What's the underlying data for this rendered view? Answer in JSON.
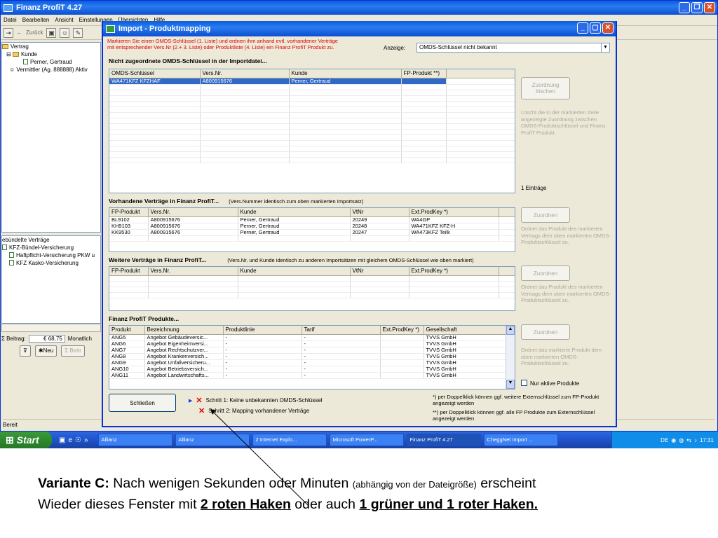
{
  "main_window": {
    "title": "Finanz ProfiT 4.27",
    "menu": [
      "Datei",
      "Bearbeiten",
      "Ansicht",
      "Einstellungen",
      "Übersichten",
      "Hilfe"
    ],
    "toolbar_back": "Zurück",
    "tree": {
      "root": "Vertrag",
      "kunde": "Kunde",
      "kunde_name": "Perner, Gertraud",
      "vermittler": "Vermittler (Ag. 888888) Aktiv"
    },
    "vertraege_panel": {
      "header": "ebündelte Verträge",
      "items": [
        "KFZ-Bündel-Versicherung",
        "Haftpflicht-Versicherung PKW u",
        "KFZ Kasko-Versicherung"
      ]
    },
    "beitrag_label": "Σ Beitrag:",
    "beitrag_value": "€ 68,75",
    "beitrag_period": "Monatlich",
    "neu_button": "Neu",
    "beitr_button": "Σ Beitr",
    "status": "Bereit"
  },
  "dialog": {
    "title": "Import - Produktmapping",
    "hint_line1": "Markieren Sie einen OMDS-Schlüssel (1. Liste) und ordnen ihm anhand evtl. vorhandener Verträge",
    "hint_line2": "mit entsprechender Vers.Nr (2.+ 3. Liste) oder Produktliste (4. Liste) ein Finanz ProfiT Produkt zu.",
    "anzeige_label": "Anzeige:",
    "anzeige_value": "OMDS-Schlüssel nicht bekannt",
    "section1": {
      "title": "Nicht zugeordnete OMDS-Schlüssel in der Importdatei...",
      "columns": [
        "OMDS-Schlüssel",
        "Vers.Nr.",
        "Kunde",
        "FP-Produkt **)"
      ],
      "rows": [
        [
          "WA471KFZ  KFZHAF",
          "A800915676",
          "Perner, Gertraud",
          ""
        ]
      ],
      "button": "Zuordnung löschen",
      "desc": "Löscht die in der markierten Zeile angezeigte Zuordnung zwischen OMDS-Produktschlüssel und Finanz ProfiT Produkt.",
      "count": "1 Einträge"
    },
    "section2": {
      "title": "Vorhandene Verträge in Finanz ProfiT...",
      "subtitle": "(Vers.Nummer identisch zum oben markierten Importsatz)",
      "columns": [
        "FP-Produkt",
        "Vers.Nr.",
        "Kunde",
        "VtNr",
        "Ext.ProdKey *)"
      ],
      "rows": [
        [
          "BL9102",
          "A800915676",
          "Perner, Gertraud",
          "20249",
          "WA4GP"
        ],
        [
          "KH9103",
          "A800915676",
          "Perner, Gertraud",
          "20248",
          "WA471KFZ  KFZ-H"
        ],
        [
          "KK9530",
          "A800915676",
          "Perner, Gertraud",
          "20247",
          "WA473KFZ  Teilk"
        ]
      ],
      "button": "Zuordnen",
      "desc": "Ordnet das Produkt des markierten Vertrags dem oben markierten OMDS-Produktschlüssel zu."
    },
    "section3": {
      "title": "Weitere Verträge in Finanz ProfiT...",
      "subtitle": "(Vers.Nr. und Kunde identisch zu anderen Importsätzen mit gleichem OMDS-Schlüssel wie oben markiert)",
      "columns": [
        "FP-Produkt",
        "Vers.Nr.",
        "Kunde",
        "VtNr",
        "Ext.ProdKey *)"
      ],
      "button": "Zuordnen",
      "desc": "Ordnet das Produkt des markierten Vertrags dem oben markierten OMDS-Produktschlüssel zu."
    },
    "section4": {
      "title": "Finanz ProfiT Produkte...",
      "columns": [
        "Produkt",
        "Bezeichnung",
        "Produktlinie",
        "Tarif",
        "Ext.ProdKey *)",
        "Gesellschaft"
      ],
      "rows": [
        [
          "ANG5",
          "Angebot Gebäudeversic...",
          "-",
          "-",
          "",
          "TVVS GmbH"
        ],
        [
          "ANG6",
          "Angebot Eigenheimversi...",
          "-",
          "-",
          "",
          "TVVS GmbH"
        ],
        [
          "ANG7",
          "Angebot Rechtschutzver...",
          "-",
          "-",
          "",
          "TVVS GmbH"
        ],
        [
          "ANG8",
          "Angebot Krankenversich...",
          "-",
          "-",
          "",
          "TVVS GmbH"
        ],
        [
          "ANG9",
          "Angebot Unfallversicheru...",
          "-",
          "-",
          "",
          "TVVS GmbH"
        ],
        [
          "ANG10",
          "Angebot Betriebsversich...",
          "-",
          "-",
          "",
          "TVVS GmbH"
        ],
        [
          "ANG11",
          "Angebot Landwirtschafts...",
          "-",
          "-",
          "",
          "TVVS GmbH"
        ]
      ],
      "button": "Zuordnen",
      "desc": "Ordnet das markierte Produkt dem oben markierten OMDS-Produktschlüssel zu.",
      "checkbox": "Nur aktive Produkte"
    },
    "close_button": "Schließen",
    "step1": "Schritt 1:  Keine unbekannten OMDS-Schlüssel",
    "step2": "Schritt 2:  Mapping vorhandener Verträge",
    "note1": "*)  per Doppelklick können ggf. weitere Externschlüssel zum FP-Produkt angezeigt werden",
    "note2": "**)  per Doppelklick können ggf. alle FP Produkte zum Externschlüssel angezeigt werden"
  },
  "taskbar": {
    "start": "Start",
    "items": [
      "Allianz",
      "Allianz",
      "2 Internet Explo...",
      "Microsoft PowerP...",
      "Finanz ProfiT 4.27",
      "CheggNet Import ..."
    ],
    "lang": "DE",
    "clock": "17:31"
  },
  "caption": {
    "variant": "Variante C:",
    "text1": " Nach wenigen Sekunden oder Minuten ",
    "small": "(abhängig von der Dateigröße)",
    "text2": " erscheint",
    "line2_text": "Wieder dieses Fenster mit ",
    "underline1": "2 roten Haken",
    "mid": " oder auch ",
    "underline2": "1 grüner und 1 roter Haken."
  }
}
